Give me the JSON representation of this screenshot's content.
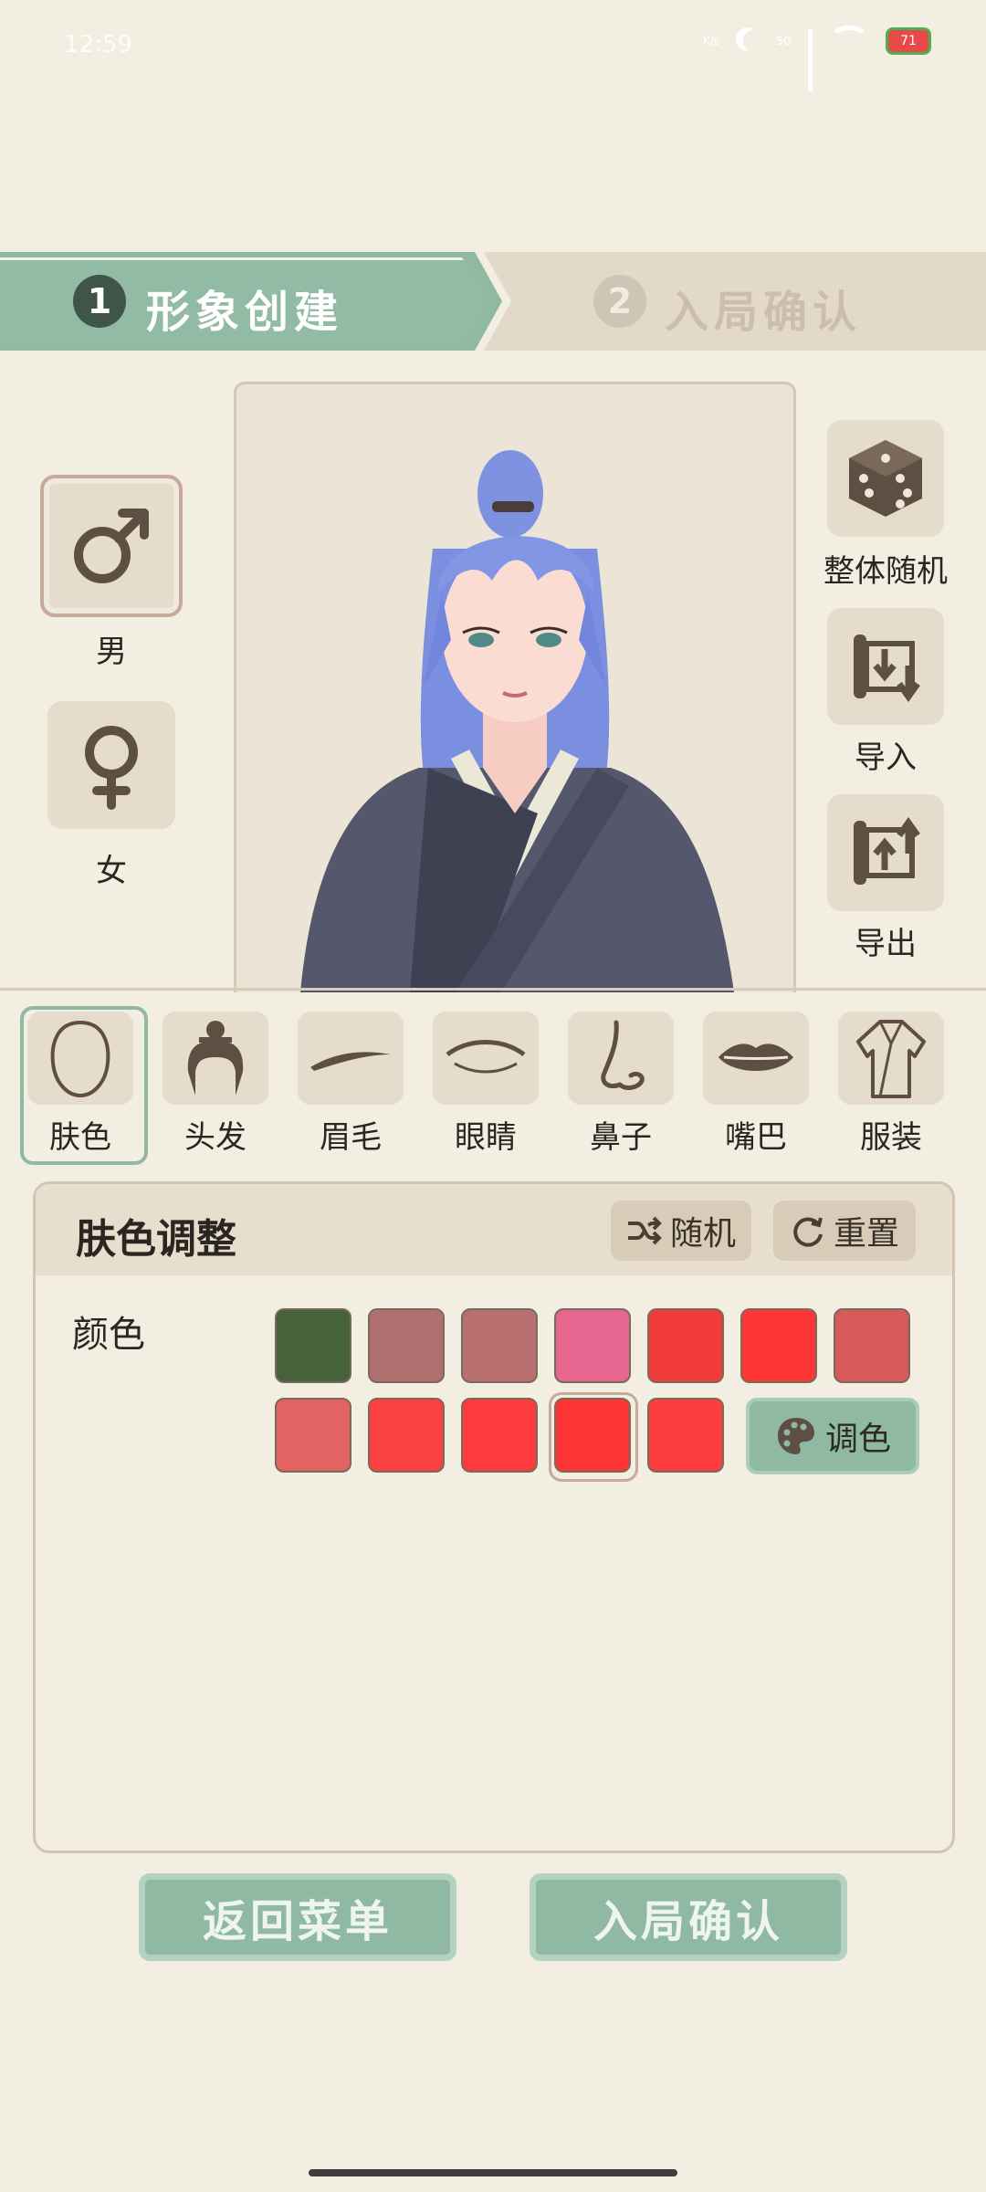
{
  "status": {
    "time": "12:59",
    "net_top": "K/s",
    "net_bottom": "",
    "signal_type": "5G",
    "battery": "71"
  },
  "steps": [
    {
      "num": "1",
      "label": "形象创建"
    },
    {
      "num": "2",
      "label": "入局确认"
    }
  ],
  "gender": {
    "male_label": "男",
    "female_label": "女",
    "male_icon": "male-symbol-icon",
    "female_icon": "female-symbol-icon"
  },
  "actions": [
    {
      "label": "整体随机",
      "icon": "dice-icon"
    },
    {
      "label": "导入",
      "icon": "import-scroll-icon"
    },
    {
      "label": "导出",
      "icon": "export-scroll-icon"
    }
  ],
  "categories": [
    {
      "label": "肤色",
      "icon": "face-outline-icon"
    },
    {
      "label": "头发",
      "icon": "hair-bun-icon"
    },
    {
      "label": "眉毛",
      "icon": "eyebrow-icon"
    },
    {
      "label": "眼睛",
      "icon": "eye-icon"
    },
    {
      "label": "鼻子",
      "icon": "nose-icon"
    },
    {
      "label": "嘴巴",
      "icon": "lips-icon"
    },
    {
      "label": "服装",
      "icon": "robe-icon"
    }
  ],
  "panel": {
    "title": "肤色调整",
    "random_label": "随机",
    "reset_label": "重置",
    "color_label": "颜色",
    "palette_label": "调色",
    "swatches_row1": [
      "#46623a",
      "#b07070",
      "#b87070",
      "#e5668e",
      "#f23c3c",
      "#ff3636",
      "#d75a5a"
    ],
    "swatches_row2": [
      "#e36262",
      "#fa4040",
      "#fc3c3c",
      "#fc3434",
      "#fc3e3e"
    ],
    "selected_swatch": "row2-4"
  },
  "bottom": {
    "back_label": "返回菜单",
    "confirm_label": "入局确认"
  }
}
